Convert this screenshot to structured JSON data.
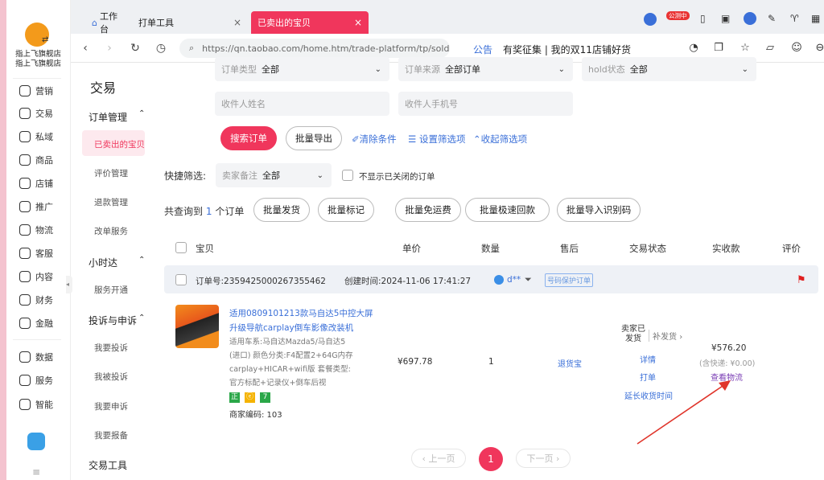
{
  "store": {
    "name_line1": "指上飞旗舰店",
    "name_line2": "指上飞旗舰店"
  },
  "leftbar": {
    "items": [
      "营销",
      "交易",
      "私域",
      "商品",
      "店铺",
      "推广",
      "物流",
      "客服",
      "内容",
      "财务",
      "金融",
      "数据",
      "服务",
      "智能"
    ]
  },
  "tabs": [
    {
      "label": "工作台"
    },
    {
      "label": "打单工具"
    },
    {
      "label": "已卖出的宝贝"
    }
  ],
  "address": {
    "url": "https://qn.taobao.com/home.htm/trade-platform/tp/sold"
  },
  "toolbar": {
    "badge": "公测中",
    "announce_tag": "公告",
    "announce_text": "有奖征集 | 我的双11店铺好货"
  },
  "subnav": {
    "title": "交易",
    "sections": [
      {
        "title": "订单管理",
        "items": [
          "已卖出的宝贝",
          "评价管理",
          "退款管理",
          "改单服务"
        ]
      },
      {
        "title": "小时达",
        "items": [
          "服务开通"
        ]
      },
      {
        "title": "投诉与申诉",
        "items": [
          "我要投诉",
          "我被投诉",
          "我要申诉",
          "我要报备"
        ]
      },
      {
        "title": "交易工具",
        "items": []
      }
    ]
  },
  "filters": {
    "order_type_label": "订单类型",
    "order_type_value": "全部",
    "order_source_label": "订单来源",
    "order_source_value": "全部订单",
    "hold_label": "hold状态",
    "hold_value": "全部",
    "buyer_name_placeholder": "收件人姓名",
    "buyer_phone_placeholder": "收件人手机号",
    "search_btn": "搜索订单",
    "export_btn": "批量导出",
    "clear_link": "清除条件",
    "settings_link": "设置筛选项",
    "collapse_link": "收起筛选项",
    "quick_label": "快捷筛选:",
    "seller_note_label": "卖家备注",
    "seller_note_value": "全部",
    "hide_closed_label": "不显示已关闭的订单"
  },
  "results": {
    "count_prefix": "共查询到",
    "count": "1",
    "count_suffix": "个订单",
    "actions": [
      "批量发货",
      "批量标记",
      "批量免运费",
      "批量极速回款",
      "批量导入识别码"
    ]
  },
  "table": {
    "headers": [
      "宝贝",
      "单价",
      "数量",
      "售后",
      "交易状态",
      "实收款",
      "评价"
    ]
  },
  "order": {
    "no_label": "订单号:",
    "no": "2359425000267355462",
    "created_label": "创建时间:",
    "created": "2024-11-06 17:41:27",
    "buyer": "d**",
    "protect_tag": "号码保护订单",
    "title_line1": "适用0809101213款马自达5中控大屏",
    "title_line2": "升级导航carplay倒车影像改装机",
    "spec_lines": [
      "适用车系:马自达Mazda5/马自达5",
      "(进口) 颜色分类:F4配置2+64G内存",
      "carplay+HICAR+wifi版  套餐类型:",
      "官方标配+记录仪+倒车后视"
    ],
    "badges": [
      "正",
      "ⓔ",
      "7"
    ],
    "merchant_code": "商家编码: 103",
    "unit_price": "¥697.78",
    "quantity": "1",
    "after_sale": "退货宝",
    "status_line1": "卖家已",
    "status_line2": "发货",
    "reship": "补发货",
    "detail_link": "详情",
    "print_link": "打单",
    "extend_link": "延长收货时间",
    "amount": "¥576.20",
    "shipping": "(含快递: ¥0.00)",
    "logistics_link": "查看物流"
  },
  "pagination": {
    "prev": "上一页",
    "current": "1",
    "next": "下一页"
  },
  "colors": {
    "accent": "#f0365c",
    "link": "#3a6fd8",
    "arrow": "#e0352b"
  }
}
